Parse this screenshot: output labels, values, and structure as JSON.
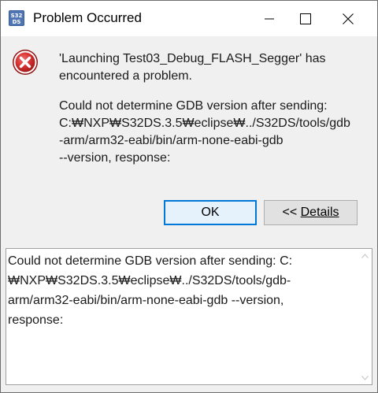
{
  "window": {
    "title": "Problem Occurred"
  },
  "message": {
    "title_lines": [
      "'Launching Test03_Debug_FLASH_Segger' has",
      "encountered a problem."
    ],
    "detail_lines": [
      "Could not determine GDB version after sending:",
      "C:₩NXP₩S32DS.3.5₩eclipse₩../S32DS/tools/gdb",
      "-arm/arm32-eabi/bin/arm-none-eabi-gdb",
      "--version, response:"
    ]
  },
  "buttons": {
    "ok_label": "OK",
    "details_prefix": "<< ",
    "details_label": "Details"
  },
  "details": {
    "lines": [
      "Could not determine GDB version after sending: C:",
      "₩NXP₩S32DS.3.5₩eclipse₩../S32DS/tools/gdb-",
      "arm/arm32-eabi/bin/arm-none-eabi-gdb --version,",
      "response:"
    ]
  },
  "colors": {
    "accent": "#0078d7",
    "error_red": "#d32f2f"
  }
}
